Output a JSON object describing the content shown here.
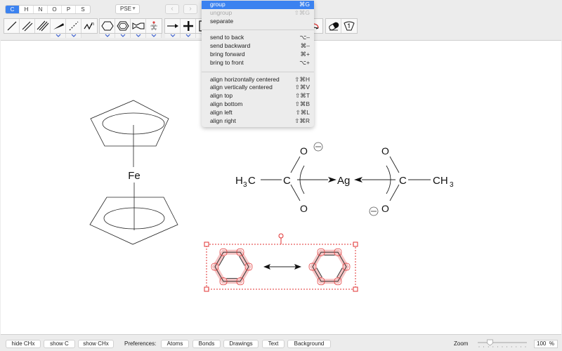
{
  "toolbar": {
    "element_tabs": [
      {
        "label": "C",
        "active": true
      },
      {
        "label": "H",
        "active": false
      },
      {
        "label": "N",
        "active": false
      },
      {
        "label": "O",
        "active": false
      },
      {
        "label": "P",
        "active": false
      },
      {
        "label": "S",
        "active": false
      }
    ],
    "pse_label": "PSE",
    "pse_caret": "▼",
    "nav_back": "‹",
    "nav_forward": "›",
    "bond_tools": [
      "single-bond-icon",
      "double-bond-icon",
      "triple-bond-icon",
      "wedge-bond-icon",
      "dashed-bond-icon",
      "chain-n-icon"
    ],
    "chain_superscript": "n",
    "ring_tools": [
      "cyclohexane-icon",
      "benzene-icon",
      "chair-ring-icon",
      "molecule-3d-icon"
    ],
    "arrow_tools": [
      "arrow-icon",
      "plus-icon",
      "bracket-icon"
    ],
    "right_tools": [
      "eraser-icon",
      "lasso-icon"
    ]
  },
  "context_menu": {
    "items": [
      {
        "label": "group",
        "shortcut": "⌘G",
        "state": "highlight"
      },
      {
        "label": "ungroup",
        "shortcut": "⇧⌘G",
        "state": "disabled"
      },
      {
        "label": "separate",
        "shortcut": "",
        "state": "normal"
      },
      {
        "separator": true
      },
      {
        "label": "send to back",
        "shortcut": "⌥–",
        "state": "normal"
      },
      {
        "label": "send backward",
        "shortcut": "⌘–",
        "state": "normal"
      },
      {
        "label": "bring forward",
        "shortcut": "⌘+",
        "state": "normal"
      },
      {
        "label": "bring to front",
        "shortcut": "⌥+",
        "state": "normal"
      },
      {
        "separator": true
      },
      {
        "label": "align horizontally centered",
        "shortcut": "⇧⌘H",
        "state": "normal"
      },
      {
        "label": "align vertically centered",
        "shortcut": "⇧⌘V",
        "state": "normal"
      },
      {
        "label": "align top",
        "shortcut": "⇧⌘T",
        "state": "normal"
      },
      {
        "label": "align bottom",
        "shortcut": "⇧⌘B",
        "state": "normal"
      },
      {
        "label": "align left",
        "shortcut": "⇧⌘L",
        "state": "normal"
      },
      {
        "label": "align right",
        "shortcut": "⇧⌘R",
        "state": "normal"
      }
    ]
  },
  "canvas": {
    "ferrocene": {
      "metal": "Fe"
    },
    "silver_acetate": {
      "left_methyl": "H",
      "left_methyl_sub": "3",
      "left_methyl_c": "C",
      "carbon": "C",
      "oxygen": "O",
      "metal": "Ag",
      "right_methyl": "CH",
      "right_methyl_sub": "3",
      "charge": "−"
    },
    "selection_color": "#e03030"
  },
  "bottom_bar": {
    "hide_chx": "hide CHx",
    "show_c": "show C",
    "show_chx": "show CHx",
    "preferences_label": "Preferences:",
    "atoms": "Atoms",
    "bonds": "Bonds",
    "drawings": "Drawings",
    "text": "Text",
    "background": "Background",
    "zoom_label": "Zoom",
    "zoom_value": "100",
    "zoom_unit": "%",
    "zoom_slider_fraction": 0.25
  },
  "colors": {
    "accent": "#3b82f0",
    "selection": "#e03030",
    "chevron": "#3a5fd0"
  }
}
